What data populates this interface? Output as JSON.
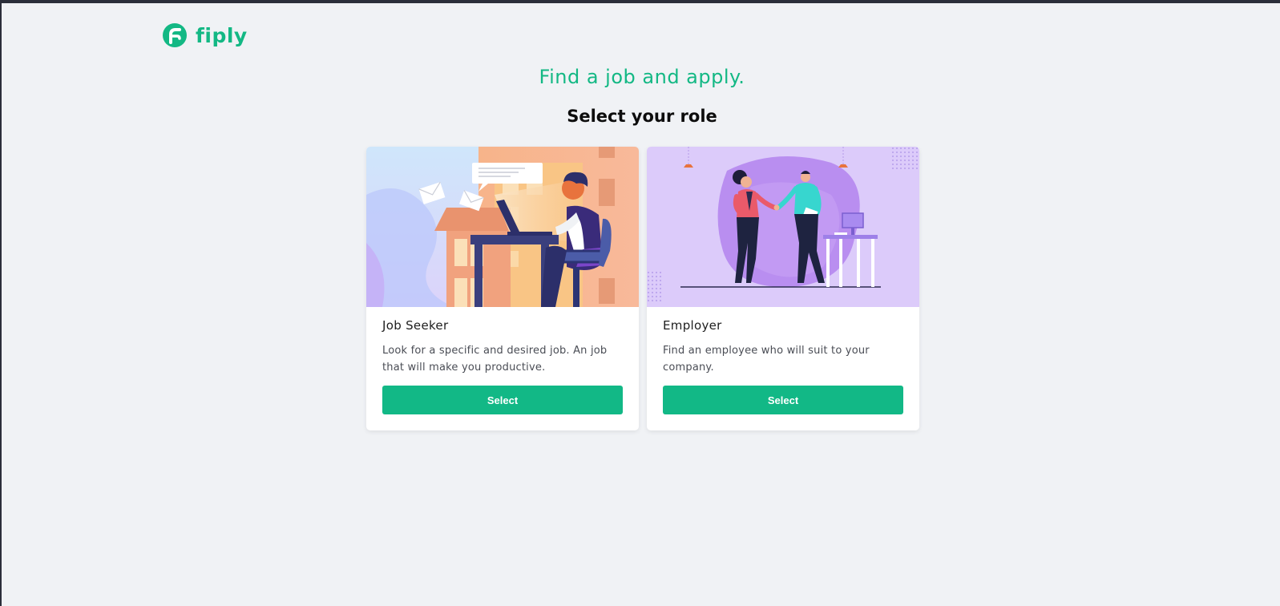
{
  "brand": {
    "name": "fiply",
    "color": "#13b884"
  },
  "hero": {
    "headline": "Find a job and apply.",
    "subheading": "Select your role"
  },
  "roles": [
    {
      "title": "Job Seeker",
      "description": "Look for a specific and desired job. An job that will make you productive.",
      "button_label": "Select"
    },
    {
      "title": "Employer",
      "description": "Find an employee who will suit to your company.",
      "button_label": "Select"
    }
  ],
  "colors": {
    "background": "#f0f2f5",
    "button": "#12b886"
  }
}
